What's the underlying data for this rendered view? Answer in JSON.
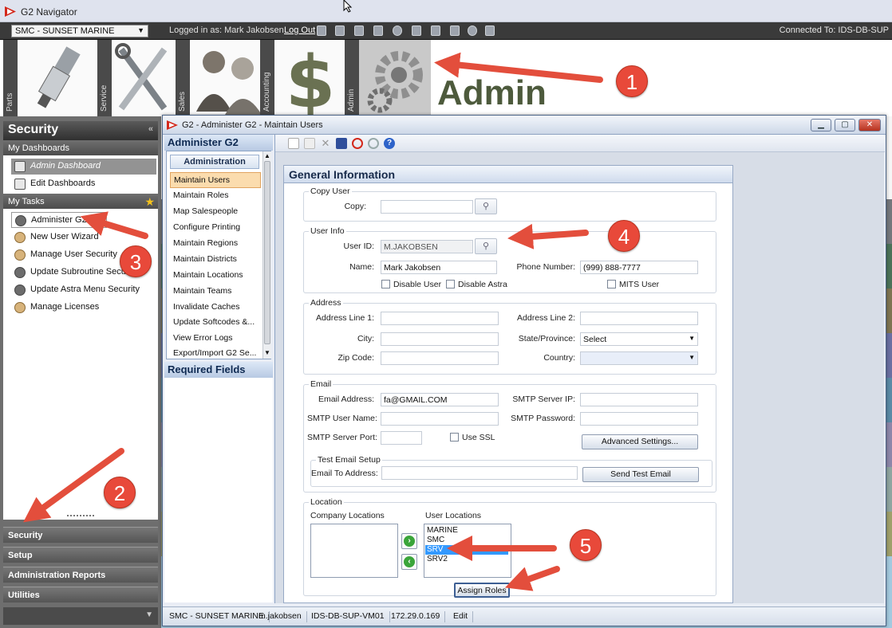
{
  "window": {
    "title": "G2 Navigator"
  },
  "topbar": {
    "company": "SMC - SUNSET MARINE",
    "logged_in": "Logged in as: Mark Jakobsen",
    "logout": "Log Out",
    "connected": "Connected To: IDS-DB-SUP"
  },
  "modules": [
    {
      "label": "Parts",
      "icon": "spark-plug-icon"
    },
    {
      "label": "Service",
      "icon": "tools-icon"
    },
    {
      "label": "Sales",
      "icon": "people-icon"
    },
    {
      "label": "Accounting",
      "icon": "dollar-icon"
    },
    {
      "label": "Admin",
      "icon": "gears-icon"
    }
  ],
  "admin_title": "Admin",
  "left": {
    "header": "Security",
    "dashboards_header": "My Dashboards",
    "dashboards": [
      "Admin Dashboard",
      "Edit Dashboards"
    ],
    "tasks_header": "My Tasks",
    "tasks": [
      "Administer G2",
      "New User Wizard",
      "Manage User Security",
      "Update Subroutine Security",
      "Update Astra Menu Security",
      "Manage Licenses"
    ],
    "bottom": [
      "Security",
      "Setup",
      "Administration Reports",
      "Utilities"
    ]
  },
  "dialog": {
    "title": "G2 - Administer G2 - Maintain Users",
    "nav_header": "Administer G2",
    "nav_group": "Administration",
    "nav_items": [
      "Maintain Users",
      "Maintain Roles",
      "Map Salespeople",
      "Configure Printing",
      "Maintain Regions",
      "Maintain Districts",
      "Maintain Locations",
      "Maintain Teams",
      "Invalidate Caches",
      "Update Softcodes &...",
      "View Error Logs",
      "Export/Import G2 Se..."
    ],
    "required_header": "Required Fields"
  },
  "form": {
    "title": "General Information",
    "copy_user": {
      "group": "Copy User",
      "label": "Copy:",
      "value": ""
    },
    "user_info": {
      "group": "User Info",
      "user_id_label": "User ID:",
      "user_id": "M.JAKOBSEN",
      "name_label": "Name:",
      "name": "Mark Jakobsen",
      "phone_label": "Phone Number:",
      "phone": "(999) 888-7777",
      "disable_user": "Disable User",
      "disable_astra": "Disable Astra",
      "mits_user": "MITS User"
    },
    "address": {
      "group": "Address",
      "line1_label": "Address Line 1:",
      "line2_label": "Address Line 2:",
      "city_label": "City:",
      "state_label": "State/Province:",
      "state_value": "Select",
      "zip_label": "Zip Code:",
      "country_label": "Country:"
    },
    "email": {
      "group": "Email",
      "address_label": "Email Address:",
      "address": "fa@GMAIL.COM",
      "smtp_ip_label": "SMTP Server IP:",
      "smtp_user_label": "SMTP User Name:",
      "smtp_pass_label": "SMTP Password:",
      "smtp_port_label": "SMTP Server Port:",
      "use_ssl": "Use SSL",
      "advanced": "Advanced Settings...",
      "test_group": "Test Email Setup",
      "to_label": "Email To Address:",
      "send_test": "Send Test Email"
    },
    "location": {
      "group": "Location",
      "company_label": "Company Locations",
      "user_label": "User Locations",
      "user_locations": [
        "MARINE",
        "SMC",
        "SRV",
        "SRV2"
      ],
      "selected": "SRV",
      "assign_roles": "Assign Roles"
    }
  },
  "statusbar": [
    "SMC - SUNSET MARINE",
    "m.jakobsen",
    "IDS-DB-SUP-VM01",
    "172.29.0.169",
    "Edit"
  ],
  "annotations": [
    "1",
    "2",
    "3",
    "4",
    "5"
  ],
  "colors": {
    "annotation": "#e34e3c",
    "selected": "#3399ff",
    "nav_active": "#fbdcae"
  }
}
